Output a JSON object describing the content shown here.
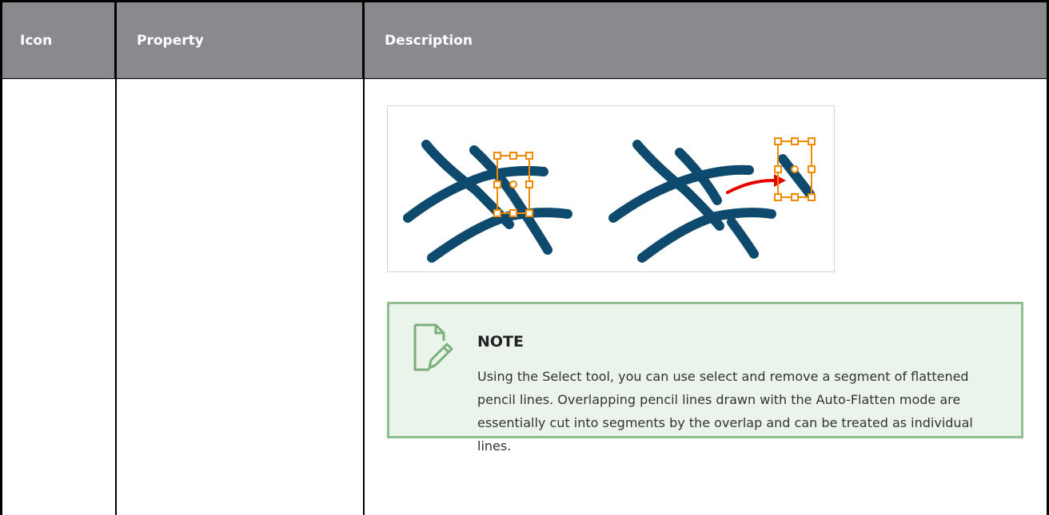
{
  "table": {
    "headers": [
      "Icon",
      "Property",
      "Description"
    ]
  },
  "note": {
    "title": "NOTE",
    "text": "Using the Select tool, you can use select and remove a segment of flattened pencil lines. Overlapping pencil lines drawn with the Auto-Flatten mode are essentially cut into segments by the overlap and can be treated as individual lines.",
    "icon": "pencil-note-icon"
  },
  "figure": {
    "stroke_color": "#0e4a6e",
    "selection_color": "#f08a00",
    "arrow_color": "#e60000"
  }
}
